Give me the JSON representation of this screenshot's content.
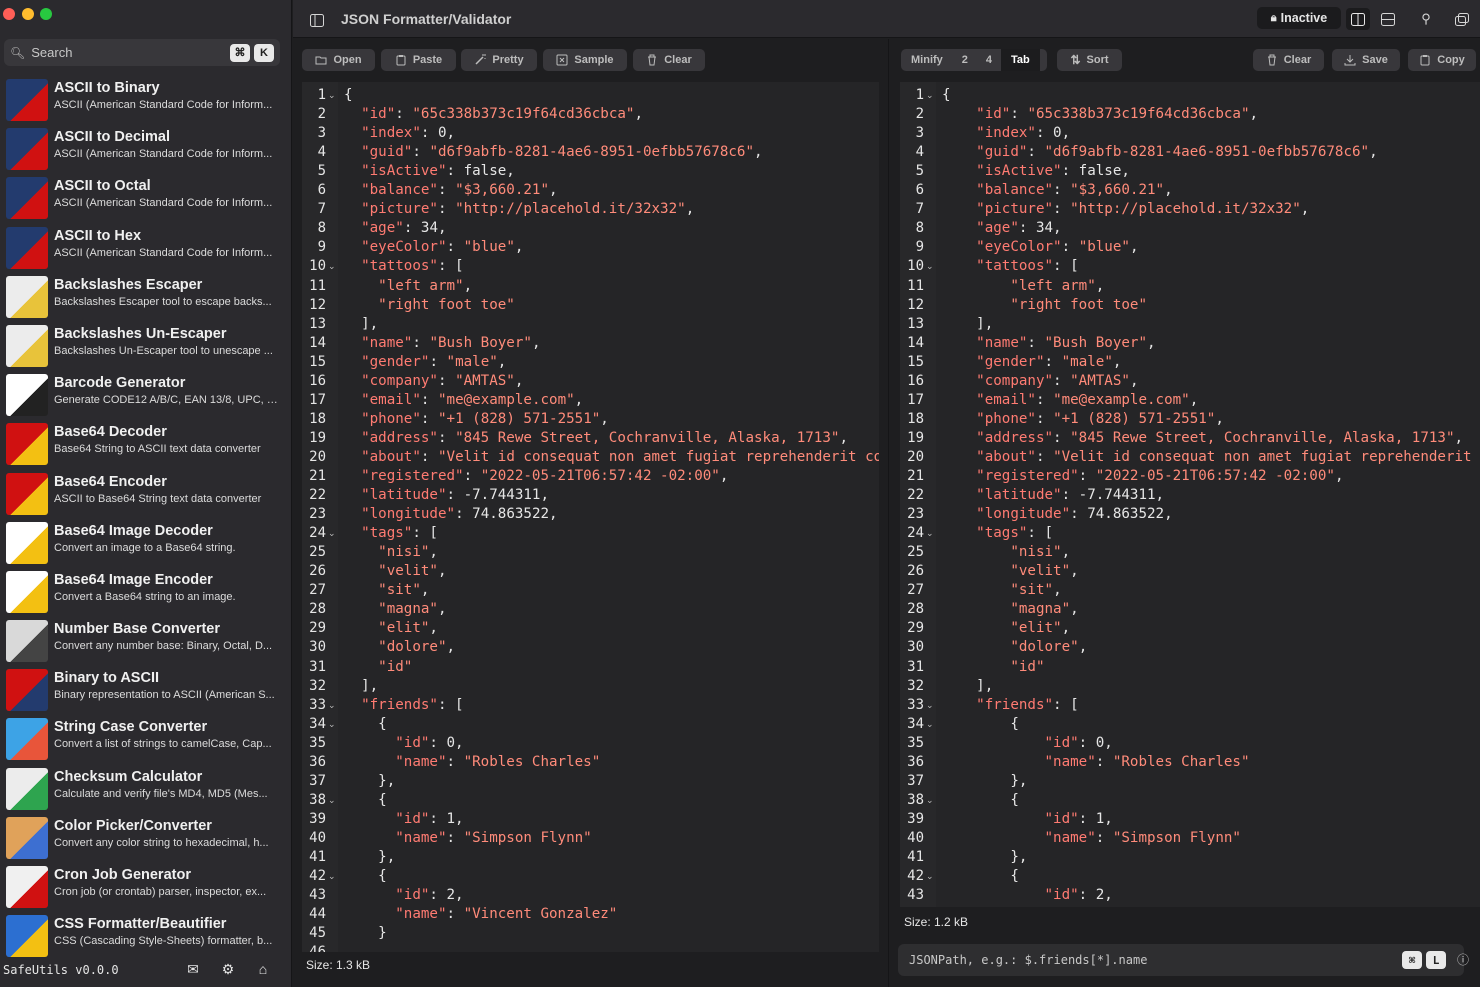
{
  "sidebar": {
    "search_placeholder": "Search",
    "shortcut": [
      "⌘",
      "K"
    ],
    "tools": [
      {
        "name": "ASCII to Binary",
        "desc": "ASCII (American Standard Code for Inform...",
        "icon": "ascii-to-binary-icon"
      },
      {
        "name": "ASCII to Decimal",
        "desc": "ASCII (American Standard Code for Inform...",
        "icon": "ascii-to-decimal-icon"
      },
      {
        "name": "ASCII to Octal",
        "desc": "ASCII (American Standard Code for Inform...",
        "icon": "ascii-to-octal-icon"
      },
      {
        "name": "ASCII to Hex",
        "desc": "ASCII (American Standard Code for Inform...",
        "icon": "ascii-to-hex-icon"
      },
      {
        "name": "Backslashes Escaper",
        "desc": "Backslashes Escaper tool to escape backs...",
        "icon": "backslashes-escaper-icon"
      },
      {
        "name": "Backslashes Un-Escaper",
        "desc": "Backslashes Un-Escaper tool to unescape ...",
        "icon": "backslashes-unescaper-icon"
      },
      {
        "name": "Barcode Generator",
        "desc": "Generate CODE12 A/B/C, EAN 13/8, UPC, C...",
        "icon": "barcode-icon"
      },
      {
        "name": "Base64 Decoder",
        "desc": "Base64 String to ASCII text data converter",
        "icon": "base64-decoder-icon"
      },
      {
        "name": "Base64 Encoder",
        "desc": "ASCII to Base64 String text data converter",
        "icon": "base64-encoder-icon"
      },
      {
        "name": "Base64 Image Decoder",
        "desc": "Convert an image to a Base64 string.",
        "icon": "base64-image-decoder-icon"
      },
      {
        "name": "Base64 Image Encoder",
        "desc": "Convert a Base64 string to an image.",
        "icon": "base64-image-encoder-icon"
      },
      {
        "name": "Number Base Converter",
        "desc": "Convert any number base: Binary, Octal, D...",
        "icon": "calculator-icon"
      },
      {
        "name": "Binary to ASCII",
        "desc": "Binary representation to ASCII (American S...",
        "icon": "binary-to-ascii-icon"
      },
      {
        "name": "String Case Converter",
        "desc": "Convert a list of strings to camelCase, Cap...",
        "icon": "string-case-icon"
      },
      {
        "name": "Checksum Calculator",
        "desc": "Calculate and verify file's MD4, MD5 (Mes...",
        "icon": "checksum-icon"
      },
      {
        "name": "Color Picker/Converter",
        "desc": "Convert any color string to hexadecimal, h...",
        "icon": "color-picker-icon"
      },
      {
        "name": "Cron Job Generator",
        "desc": "Cron job (or crontab) parser, inspector, ex...",
        "icon": "cron-icon"
      },
      {
        "name": "CSS Formatter/Beautifier",
        "desc": "CSS (Cascading Style-Sheets) formatter, b...",
        "icon": "css-icon"
      }
    ],
    "version": "SafeUtils v0.0.0"
  },
  "titlebar": {
    "title": "JSON Formatter/Validator",
    "status": "Inactive"
  },
  "input_toolbar": {
    "open": "Open",
    "paste": "Paste",
    "pretty": "Pretty",
    "sample": "Sample",
    "clear": "Clear"
  },
  "output_toolbar": {
    "minify": "Minify",
    "two": "2",
    "four": "4",
    "tab": "Tab",
    "sort": "Sort",
    "clear": "Clear",
    "save": "Save",
    "copy": "Copy"
  },
  "input_size": "Size: 1.3 kB",
  "output_size": "Size: 1.2 kB",
  "jsonpath_placeholder": "JSONPath, e.g.: $.friends[*].name",
  "jsonpath_shortcut": [
    "⌘",
    "L"
  ],
  "input_lines": [
    "{",
    "  \"id\": \"65c338b373c19f64cd36cbca\",",
    "  \"index\": 0,",
    "  \"guid\": \"d6f9abfb-8281-4ae6-8951-0efbb57678c6\",",
    "  \"isActive\": false,",
    "  \"balance\": \"$3,660.21\",",
    "  \"picture\": \"http://placehold.it/32x32\",",
    "  \"age\": 34,",
    "  \"eyeColor\": \"blue\",",
    "  \"tattoos\": [",
    "    \"left arm\",",
    "    \"right foot toe\"",
    "  ],",
    "  \"name\": \"Bush Boyer\",",
    "  \"gender\": \"male\",",
    "  \"company\": \"AMTAS\",",
    "  \"email\": \"me@example.com\",",
    "  \"phone\": \"+1 (828) 571-2551\",",
    "  \"address\": \"845 Rewe Street, Cochranville, Alaska, 1713\",",
    "  \"about\": \"Velit id consequat non amet fugiat reprehenderit co",
    "  \"registered\": \"2022-05-21T06:57:42 -02:00\",",
    "  \"latitude\": -7.744311,",
    "  \"longitude\": 74.863522,",
    "  \"tags\": [",
    "    \"nisi\",",
    "    \"velit\",",
    "    \"sit\",",
    "    \"magna\",",
    "    \"elit\",",
    "    \"dolore\",",
    "    \"id\"",
    "  ],",
    "  \"friends\": [",
    "    {",
    "      \"id\": 0,",
    "      \"name\": \"Robles Charles\"",
    "    },",
    "    {",
    "      \"id\": 1,",
    "      \"name\": \"Simpson Flynn\"",
    "    },",
    "    {",
    "      \"id\": 2,",
    "      \"name\": \"Vincent Gonzalez\"",
    "    }"
  ],
  "output_lines": [
    "{",
    "\t\"id\": \"65c338b373c19f64cd36cbca\",",
    "\t\"index\": 0,",
    "\t\"guid\": \"d6f9abfb-8281-4ae6-8951-0efbb57678c6\",",
    "\t\"isActive\": false,",
    "\t\"balance\": \"$3,660.21\",",
    "\t\"picture\": \"http://placehold.it/32x32\",",
    "\t\"age\": 34,",
    "\t\"eyeColor\": \"blue\",",
    "\t\"tattoos\": [",
    "\t\t\"left arm\",",
    "\t\t\"right foot toe\"",
    "\t],",
    "\t\"name\": \"Bush Boyer\",",
    "\t\"gender\": \"male\",",
    "\t\"company\": \"AMTAS\",",
    "\t\"email\": \"me@example.com\",",
    "\t\"phone\": \"+1 (828) 571-2551\",",
    "\t\"address\": \"845 Rewe Street, Cochranville, Alaska, 1713\",",
    "\t\"about\": \"Velit id consequat non amet fugiat reprehenderit",
    "\t\"registered\": \"2022-05-21T06:57:42 -02:00\",",
    "\t\"latitude\": -7.744311,",
    "\t\"longitude\": 74.863522,",
    "\t\"tags\": [",
    "\t\t\"nisi\",",
    "\t\t\"velit\",",
    "\t\t\"sit\",",
    "\t\t\"magna\",",
    "\t\t\"elit\",",
    "\t\t\"dolore\",",
    "\t\t\"id\"",
    "\t],",
    "\t\"friends\": [",
    "\t\t{",
    "\t\t\t\"id\": 0,",
    "\t\t\t\"name\": \"Robles Charles\"",
    "\t\t},",
    "\t\t{",
    "\t\t\t\"id\": 1,",
    "\t\t\t\"name\": \"Simpson Flynn\"",
    "\t\t},",
    "\t\t{",
    "\t\t\t\"id\": 2,"
  ],
  "fold_lines": [
    1,
    10,
    24,
    33,
    34,
    38,
    42
  ],
  "colors": {
    "string": "#ff8b7a",
    "key": "#ff7b72",
    "plain": "#e6e6e6",
    "accent_active": "#1c1c1e"
  }
}
